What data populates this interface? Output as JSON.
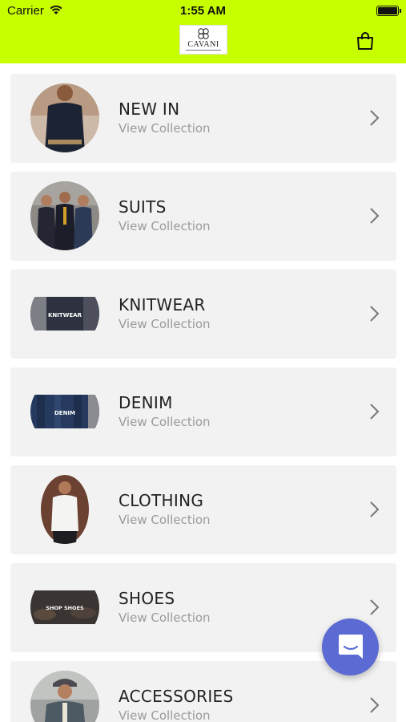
{
  "status_bar": {
    "carrier": "Carrier",
    "time": "1:55 AM",
    "wifi_icon": "wifi-icon",
    "battery_icon": "battery-icon"
  },
  "header": {
    "background": "#c8ff00",
    "logo_text": "CAVANI",
    "bag_icon": "shopping-bag-icon"
  },
  "collections": [
    {
      "title": "NEW IN",
      "subtitle": "View Collection",
      "image": "man-in-navy-shirt"
    },
    {
      "title": "SUITS",
      "subtitle": "View Collection",
      "image": "men-in-suits"
    },
    {
      "title": "KNITWEAR",
      "subtitle": "View Collection",
      "image": "knitwear-banner"
    },
    {
      "title": "DENIM",
      "subtitle": "View Collection",
      "image": "denim-banner"
    },
    {
      "title": "CLOTHING",
      "subtitle": "View Collection",
      "image": "man-in-white-shirt"
    },
    {
      "title": "SHOES",
      "subtitle": "View Collection",
      "image": "shop-shoes-banner"
    },
    {
      "title": "ACCESSORIES",
      "subtitle": "View Collection",
      "image": "man-in-tweed-cap"
    }
  ],
  "banner_text": {
    "knitwear": "KNITWEAR",
    "denim": "DENIM",
    "shoes": "SHOP SHOES"
  },
  "chat_button": {
    "icon": "chat-icon",
    "color": "#5c6ad3"
  }
}
